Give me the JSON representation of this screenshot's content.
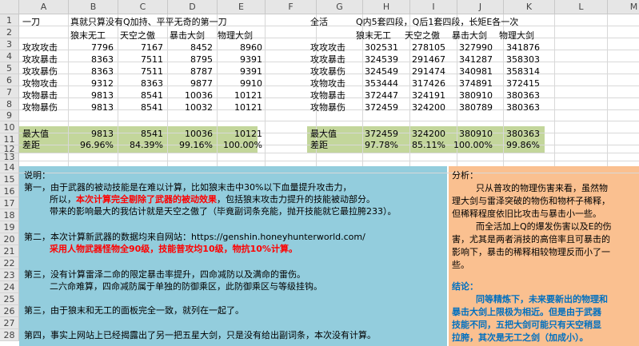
{
  "columns": [
    "A",
    "B",
    "C",
    "D",
    "E",
    "F",
    "G",
    "H",
    "I",
    "J",
    "K",
    "L",
    "M"
  ],
  "rows": [
    "1",
    "2",
    "3",
    "4",
    "5",
    "6",
    "7",
    "8",
    "9",
    "10",
    "11",
    "12",
    "13",
    "14",
    "15",
    "16",
    "17",
    "18",
    "19",
    "20",
    "21",
    "22",
    "23",
    "24",
    "25",
    "26",
    "27",
    "28",
    "29",
    "30"
  ],
  "left_table": {
    "title": "一刀",
    "subtitle": "真就只算没有Q加持、平平无奇的第一刀",
    "headers": [
      "狼末无工",
      "天空之傲",
      "暴击大剑",
      "物理大剑"
    ],
    "rows": [
      {
        "label": "攻攻攻击",
        "values": [
          "7796",
          "7167",
          "8452",
          "8960"
        ]
      },
      {
        "label": "攻攻暴击",
        "values": [
          "8363",
          "7511",
          "8795",
          "9391"
        ]
      },
      {
        "label": "攻攻暴伤",
        "values": [
          "8363",
          "7511",
          "8787",
          "9391"
        ]
      },
      {
        "label": "攻物攻击",
        "values": [
          "9312",
          "8363",
          "9877",
          "9910"
        ]
      },
      {
        "label": "攻物暴击",
        "values": [
          "9813",
          "8541",
          "10036",
          "10121"
        ]
      },
      {
        "label": "攻物暴伤",
        "values": [
          "9813",
          "8541",
          "10032",
          "10121"
        ]
      }
    ],
    "max_label": "最大值",
    "max_values": [
      "9813",
      "8541",
      "10036",
      "10121"
    ],
    "gap_label": "差距",
    "gap_values": [
      "96.96%",
      "84.39%",
      "99.16%",
      "100.00%"
    ]
  },
  "right_table": {
    "title": "全活",
    "subtitle": "Q内5套四段，Q后1套四段，长矩E各一次",
    "headers": [
      "狼末无工",
      "天空之傲",
      "暴击大剑",
      "物理大剑"
    ],
    "rows": [
      {
        "label": "攻攻攻击",
        "values": [
          "302531",
          "278105",
          "327990",
          "341876"
        ]
      },
      {
        "label": "攻攻暴击",
        "values": [
          "324539",
          "291467",
          "341287",
          "358303"
        ]
      },
      {
        "label": "攻攻暴伤",
        "values": [
          "324549",
          "291474",
          "340981",
          "358314"
        ]
      },
      {
        "label": "攻物攻击",
        "values": [
          "353444",
          "317426",
          "374891",
          "372415"
        ]
      },
      {
        "label": "攻物暴击",
        "values": [
          "372447",
          "324191",
          "380910",
          "380363"
        ]
      },
      {
        "label": "攻物暴伤",
        "values": [
          "372459",
          "324200",
          "380789",
          "380363"
        ]
      }
    ],
    "max_label": "最大值",
    "max_values": [
      "372459",
      "324200",
      "380910",
      "380363"
    ],
    "gap_label": "差距",
    "gap_values": [
      "97.78%",
      "85.11%",
      "100.00%",
      "99.86%"
    ]
  },
  "notes": {
    "heading": "说明：",
    "p1_a": "第一，由于武器的被动技能是在难以计算，比如狼末击中30%以下血量提升攻击力，",
    "p1_b_pre": "所以，",
    "p1_b_red": "本次计算完全剔除了武器的被动效果",
    "p1_b_post": "，包括狼末攻击力提升的技能被动部分。",
    "p1_c": "带来的影响最大的我估计就是天空之傲了（毕竟副词条充能，抛开技能就它最拉胯233）。",
    "p2_a": "第二，本次计算新武器的数据均来自网站：https://genshin.honeyhunterworld.com/",
    "p2_b_red": "采用人物武器怪物全90级，技能普攻均10级，物抗10%计算。",
    "p3_a": "第三，没有计算雷泽二命的限定暴击率提升，四命减防以及满命的雷伤。",
    "p3_b": "二六命难算，四命减防属于单独的防御乘区，此防御乘区与等级挂钩。",
    "p4": "第三，由于狼末和无工的面板完全一致，就列在一起了。",
    "p5": "第四，事实上网站上已经揭露出了另一把五星大剑，只是没有给出副词条，本次没有计算。"
  },
  "analysis": {
    "heading": "分析：",
    "lines": [
      "只从普攻的物理伤害来看，虽然物",
      "理大剑与雷泽突破的物伤和物杯子稀释，",
      "但稀释程度依旧比攻击与暴击小一些。",
      "而全活加上Q的爆发伤害以及E的伤",
      "害，尤其是两者消技的高倍率且可暴击的",
      "影响下，暴击的稀释相较物理反而小了一",
      "些。"
    ],
    "conclusion_heading": "结论：",
    "conclusion_lines": [
      "同等精炼下，未来要新出的物理和",
      "暴击大剑上限极为相近。但是由于武器",
      "技能不同，五把大剑可能只有天空稍显",
      "拉胯，其次是无工之剑（加成小）。"
    ]
  }
}
